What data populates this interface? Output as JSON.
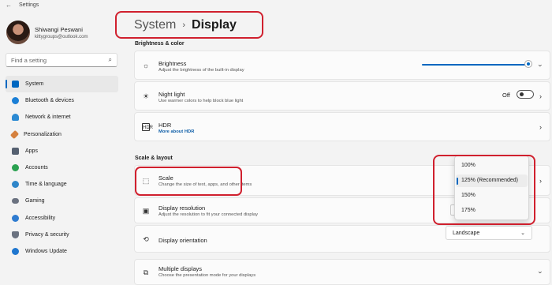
{
  "window": {
    "title": "Settings"
  },
  "profile": {
    "name": "Shiwangi Peswani",
    "email": "kittygroups@outlook.com"
  },
  "search": {
    "placeholder": "Find a setting"
  },
  "nav": {
    "items": [
      {
        "label": "System",
        "icon": "monitor-icon",
        "color": "#0067c0"
      },
      {
        "label": "Bluetooth & devices",
        "icon": "bluetooth-icon",
        "color": "#1b7fd6"
      },
      {
        "label": "Network & internet",
        "icon": "wifi-icon",
        "color": "#2c8ad3"
      },
      {
        "label": "Personalization",
        "icon": "brush-icon",
        "color": "#d5813e"
      },
      {
        "label": "Apps",
        "icon": "apps-icon",
        "color": "#556070"
      },
      {
        "label": "Accounts",
        "icon": "person-icon",
        "color": "#2aa150"
      },
      {
        "label": "Time & language",
        "icon": "globe-icon",
        "color": "#2f86c9"
      },
      {
        "label": "Gaming",
        "icon": "controller-icon",
        "color": "#6b7280"
      },
      {
        "label": "Accessibility",
        "icon": "accessibility-icon",
        "color": "#2e7bd0"
      },
      {
        "label": "Privacy & security",
        "icon": "shield-icon",
        "color": "#6b7280"
      },
      {
        "label": "Windows Update",
        "icon": "update-icon",
        "color": "#1f76cf"
      }
    ]
  },
  "breadcrumb": {
    "parent": "System",
    "separator": "›",
    "current": "Display"
  },
  "sections": {
    "brightness_color": "Brightness & color",
    "scale_layout": "Scale & layout"
  },
  "settings": {
    "brightness": {
      "title": "Brightness",
      "desc": "Adjust the brightness of the built-in display",
      "value": 1.0
    },
    "night_light": {
      "title": "Night light",
      "desc": "Use warmer colors to help block blue light",
      "toggle_label": "Off",
      "enabled": false
    },
    "hdr": {
      "title": "HDR",
      "link": "More about HDR"
    },
    "scale": {
      "title": "Scale",
      "desc": "Change the size of text, apps, and other items"
    },
    "display_resolution": {
      "title": "Display resolution",
      "desc": "Adjust the resolution to fit your connected display"
    },
    "display_orientation": {
      "title": "Display orientation",
      "value": "Landscape"
    },
    "multiple_displays": {
      "title": "Multiple displays",
      "desc": "Choose the presentation mode for your displays"
    }
  },
  "scale_dropdown": {
    "options": [
      "100%",
      "125% (Recommended)",
      "150%",
      "175%"
    ],
    "selected_index": 1
  },
  "colors": {
    "accent": "#0067c0",
    "highlight": "#d0202e"
  }
}
